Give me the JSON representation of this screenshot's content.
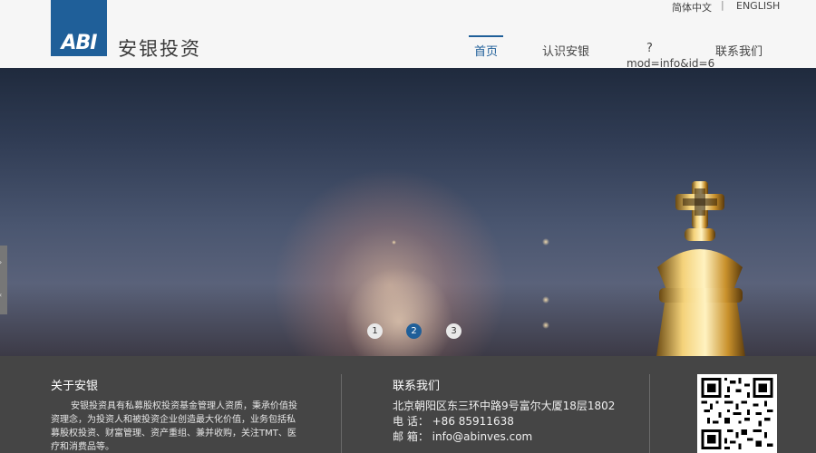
{
  "brand": {
    "logo_mark": "ABI",
    "logo_text": "安银投资"
  },
  "lang": {
    "simplified_chinese": "简体中文",
    "separator": "|",
    "english": "ENGLISH"
  },
  "nav": {
    "home": "首页",
    "about": "认识安银",
    "unknown": "?",
    "unknown_link": "mod=info&id=6",
    "contact": "联系我们"
  },
  "carousel": {
    "dots": [
      "1",
      "2",
      "3"
    ],
    "active_index": 1
  },
  "footer": {
    "about_title": "关于安银",
    "about_body": "安银投资具有私募股权投资基金管理人资质，秉承价值投资理念，为投资人和被投资企业创造最大化价值，业务包括私募股权投资、财富管理、资产重组、兼并收购，关注TMT、医疗和消费品等。",
    "contact_title": "联系我们",
    "address": "北京朝阳区东三环中路9号富尔大厦18层1802",
    "phone": "电 话： +86 85911638",
    "email": "邮 箱： info@abinves.com"
  },
  "colors": {
    "brand_blue": "#1f5f99",
    "footer_bg": "#454545",
    "header_bg": "#f6f6f6"
  },
  "icons": {
    "prev_arrow": "chevron-icon",
    "qr": "qr-code-icon"
  }
}
